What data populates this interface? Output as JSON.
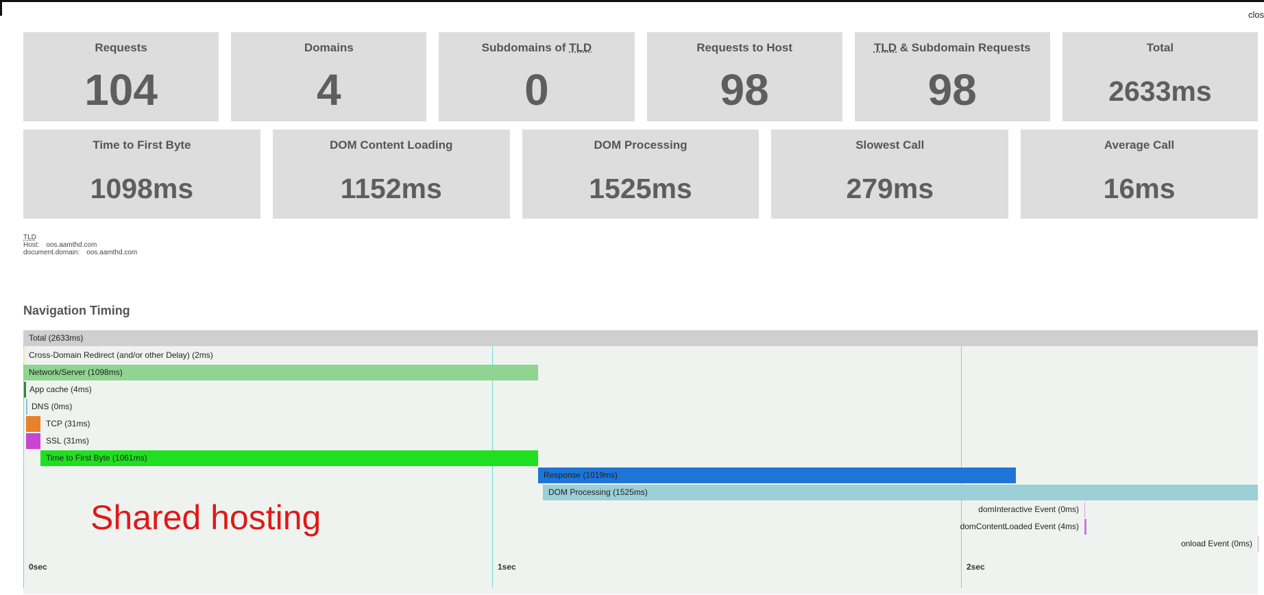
{
  "close_label": "clos",
  "row1": [
    {
      "title": "Requests",
      "value": "104"
    },
    {
      "title": "Domains",
      "value": "4"
    },
    {
      "title_parts": [
        "Subdomains of ",
        "TLD",
        ""
      ],
      "value": "0"
    },
    {
      "title": "Requests to Host",
      "value": "98"
    },
    {
      "title_parts": [
        "",
        "TLD",
        " & Subdomain Requests"
      ],
      "value": "98"
    },
    {
      "title": "Total",
      "value": "2633ms"
    }
  ],
  "row2": [
    {
      "title": "Time to First Byte",
      "value": "1098ms"
    },
    {
      "title": "DOM Content Loading",
      "value": "1152ms"
    },
    {
      "title": "DOM Processing",
      "value": "1525ms"
    },
    {
      "title": "Slowest Call",
      "value": "279ms"
    },
    {
      "title": "Average Call",
      "value": "16ms"
    }
  ],
  "tld": {
    "label": "TLD",
    "host_label": "Host:",
    "host_value": "oos.aamthd.com",
    "doc_label": "document.domain:",
    "doc_value": "oos.aamthd.com"
  },
  "section_title": "Navigation Timing",
  "timing": {
    "total_ms": 2633,
    "ticks": [
      "0sec",
      "1sec",
      "2sec"
    ],
    "bars": [
      {
        "label": "Total (2633ms)",
        "start": 0,
        "duration": 2633,
        "color": "#cfcfcf"
      },
      {
        "label": "Cross-Domain Redirect (and/or other Delay) (2ms)",
        "start": 0,
        "duration": 2,
        "color": "#f0e8a8"
      },
      {
        "label": "Network/Server (1098ms)",
        "start": 0,
        "duration": 1098,
        "color": "#8fd490"
      },
      {
        "label": "App cache (4ms)",
        "start": 2,
        "duration": 4,
        "color": "#2e8b3a"
      },
      {
        "label": "DNS (0ms)",
        "start": 6,
        "duration": 0,
        "color": "#7ec6d8"
      },
      {
        "label": "TCP (31ms)",
        "start": 6,
        "duration": 31,
        "color": "#e8822a"
      },
      {
        "label": "SSL (31ms)",
        "start": 6,
        "duration": 31,
        "color": "#c945cf"
      },
      {
        "label": "Time to First Byte (1061ms)",
        "start": 37,
        "duration": 1061,
        "color": "#1fe01f"
      },
      {
        "label": "Response (1019ms)",
        "start": 1098,
        "duration": 1019,
        "color": "#1f74d8"
      },
      {
        "label": "DOM Processing (1525ms)",
        "start": 1108,
        "duration": 1525,
        "color": "#9ccfd6"
      }
    ],
    "events": [
      {
        "label": "domInteractive Event (0ms)",
        "at": 2263,
        "duration": 0,
        "color": "#d8a0e0"
      },
      {
        "label": "domContentLoaded Event (4ms)",
        "at": 2263,
        "duration": 4,
        "color": "#c77ad8"
      },
      {
        "label": "onload Event (0ms)",
        "at": 2633,
        "duration": 0,
        "color": "#d8a0e0"
      }
    ]
  },
  "annotation": "Shared hosting"
}
